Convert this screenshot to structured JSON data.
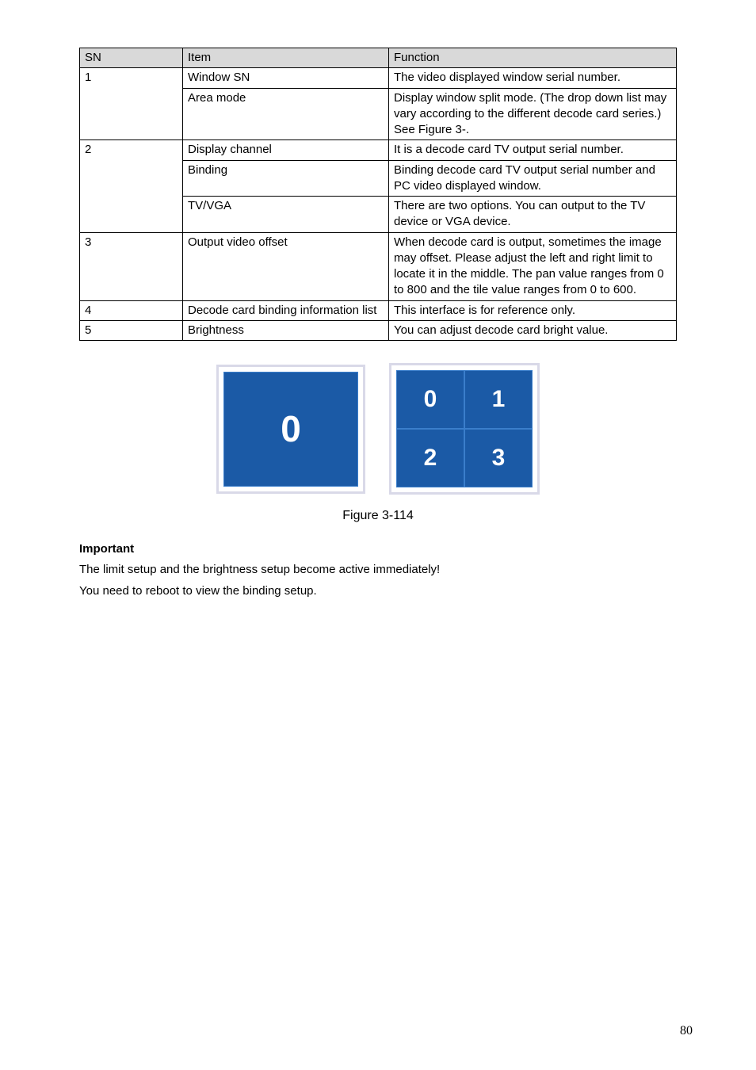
{
  "table": {
    "headers": {
      "sn": "SN",
      "item": "Item",
      "func": "Function"
    },
    "rows": [
      {
        "sn": "1",
        "item": "Window SN",
        "func": "The video displayed window serial number."
      },
      {
        "sn": "",
        "item": "Area mode",
        "func": "Display window split mode. (The drop down list may vary according to the different decode card series.) See Figure 3-."
      },
      {
        "sn": "2",
        "item": "Display channel",
        "func": "It is a decode card TV output serial number."
      },
      {
        "sn": "",
        "item": "Binding",
        "func": "Binding decode card TV output serial number and PC video displayed window."
      },
      {
        "sn": "",
        "item": "TV/VGA",
        "func": "There are two options. You can output to the TV device or VGA device."
      },
      {
        "sn": "3",
        "item": "Output video offset",
        "func": "When decode card is output, sometimes the image may offset. Please adjust the left and right limit to locate it in the middle. The pan value ranges from 0 to 800 and the tile value ranges from 0 to 600."
      },
      {
        "sn": "4",
        "item": "Decode card binding information list",
        "func": "This interface is for reference only."
      },
      {
        "sn": "5",
        "item": "Brightness",
        "func": "You can adjust decode card bright value."
      }
    ]
  },
  "figure": {
    "single": "0",
    "grid": [
      "0",
      "1",
      "2",
      "3"
    ],
    "caption": "Figure 3-114"
  },
  "important": {
    "head": "Important",
    "line1": "The limit setup and the brightness setup become active immediately!",
    "line2": "You need to reboot to view the binding setup."
  },
  "page_number": "80"
}
